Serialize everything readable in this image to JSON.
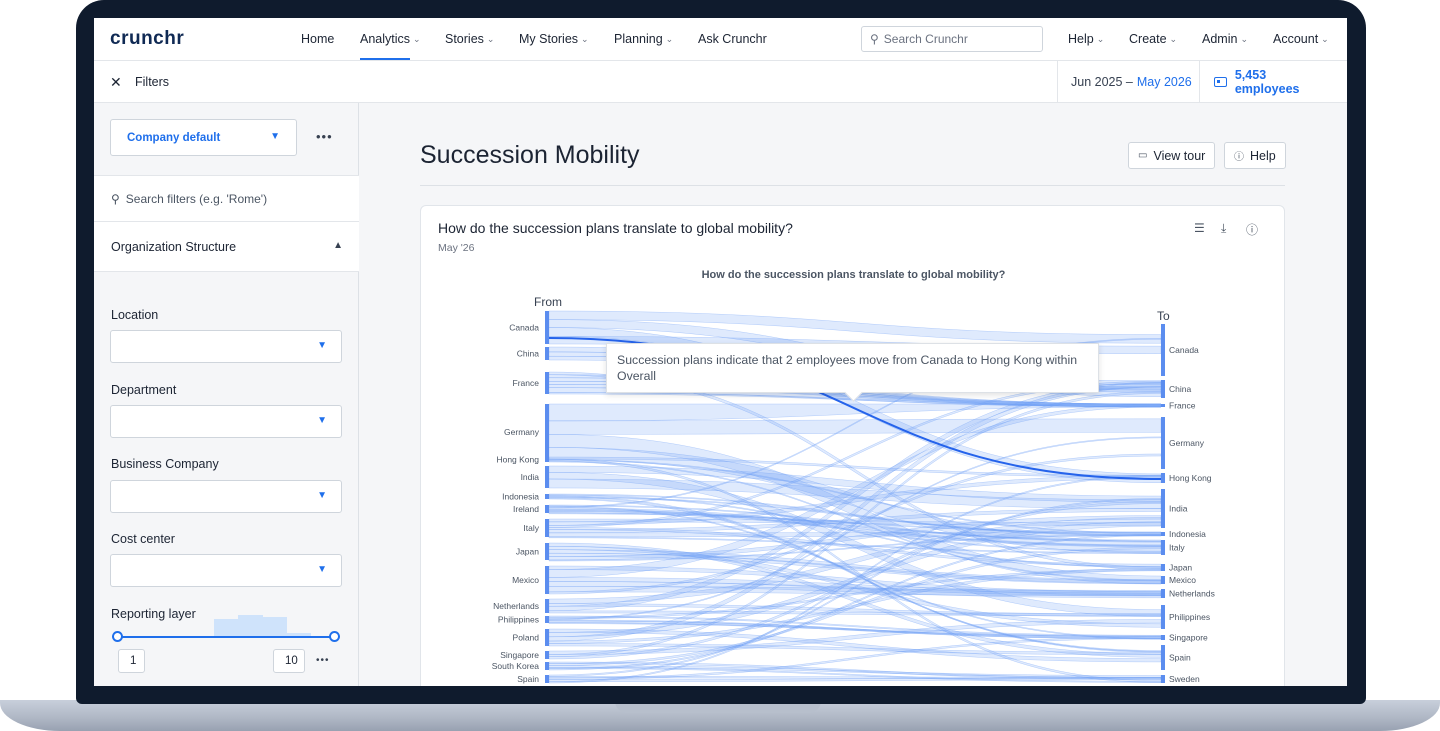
{
  "app": {
    "logo": "crunchr"
  },
  "nav": {
    "items": [
      {
        "label": "Home",
        "chevron": false
      },
      {
        "label": "Analytics",
        "chevron": true
      },
      {
        "label": "Stories",
        "chevron": true
      },
      {
        "label": "My Stories",
        "chevron": true
      },
      {
        "label": "Planning",
        "chevron": true
      },
      {
        "label": "Ask Crunchr",
        "chevron": false
      }
    ],
    "active": "Analytics",
    "search_placeholder": "Search Crunchr",
    "right_items": [
      {
        "label": "Help"
      },
      {
        "label": "Create"
      },
      {
        "label": "Admin"
      },
      {
        "label": "Account"
      }
    ]
  },
  "filterbar": {
    "label": "Filters",
    "date_start": "Jun 2025 –",
    "date_end": "May 2026",
    "employees": "5,453 employees"
  },
  "sidebar": {
    "preset": "Company default",
    "search_placeholder": "Search filters (e.g. 'Rome')",
    "section": "Organization Structure",
    "filters": [
      {
        "label": "Location"
      },
      {
        "label": "Department"
      },
      {
        "label": "Business Company"
      },
      {
        "label": "Cost center"
      }
    ],
    "reporting_layer": {
      "label": "Reporting layer",
      "min": "1",
      "max": "10"
    }
  },
  "main": {
    "title": "Succession Mobility",
    "view_tour": "View tour",
    "help": "Help"
  },
  "card": {
    "question": "How do the succession plans translate to global mobility?",
    "date": "May '26",
    "tooltip": "Succession plans indicate that 2 employees move from Canada to Hong Kong within Overall"
  },
  "chart_data": {
    "type": "sankey",
    "title": "How do the succession plans translate to global mobility?",
    "from_label": "From",
    "to_label": "To",
    "source_nodes": [
      "Canada",
      "China",
      "France",
      "Germany",
      "Hong Kong",
      "India",
      "Indonesia",
      "Ireland",
      "Italy",
      "Japan",
      "Mexico",
      "Netherlands",
      "Philippines",
      "Poland",
      "Singapore",
      "South Korea",
      "Spain"
    ],
    "target_nodes": [
      "Canada",
      "China",
      "France",
      "Germany",
      "Hong Kong",
      "India",
      "Indonesia",
      "Italy",
      "Japan",
      "Mexico",
      "Netherlands",
      "Philippines",
      "Singapore",
      "Spain",
      "Sweden"
    ],
    "highlighted_flow": {
      "from": "Canada",
      "to": "Hong Kong",
      "value": 2
    }
  },
  "colors": {
    "accent": "#1f6feb",
    "flow": "#6f9ff5",
    "node": "#5b8def"
  }
}
